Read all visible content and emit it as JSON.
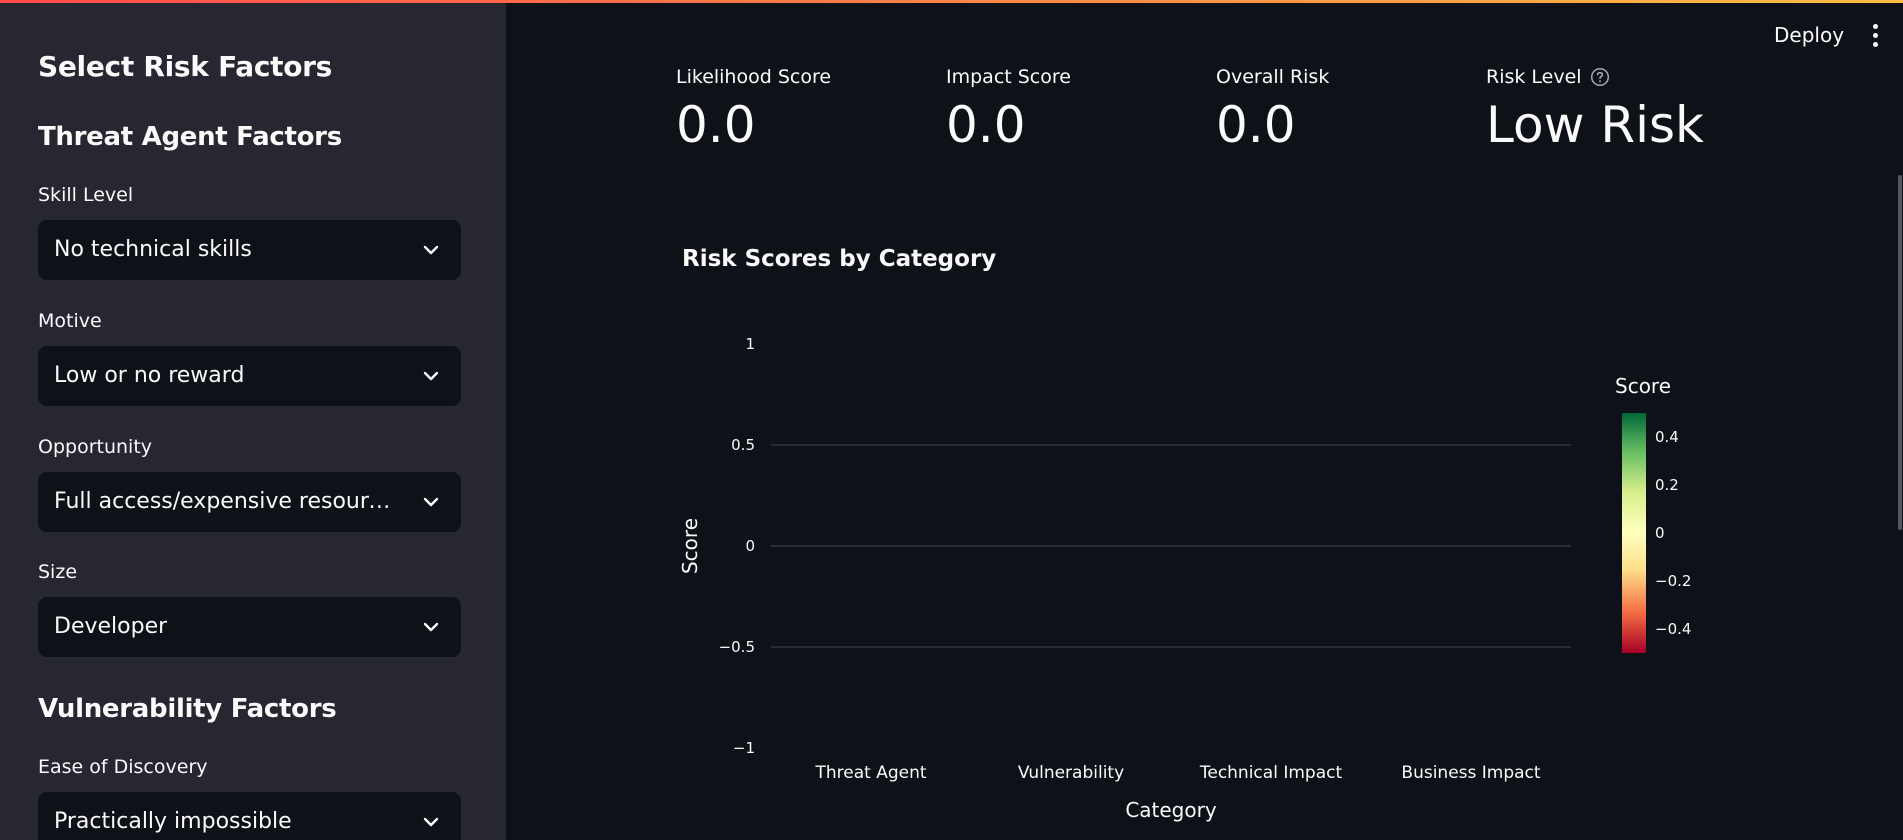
{
  "sidebar": {
    "title": "Select Risk Factors",
    "sections": {
      "threat_agent": "Threat Agent Factors",
      "vulnerability": "Vulnerability Factors"
    },
    "fields": {
      "skill_level": {
        "label": "Skill Level",
        "value": "No technical skills"
      },
      "motive": {
        "label": "Motive",
        "value": "Low or no reward"
      },
      "opportunity": {
        "label": "Opportunity",
        "value": "Full access/expensive resource ..."
      },
      "size": {
        "label": "Size",
        "value": "Developer"
      },
      "ease_of_discovery": {
        "label": "Ease of Discovery",
        "value": "Practically impossible"
      }
    }
  },
  "header": {
    "deploy_label": "Deploy",
    "menu_icon": "kebab-menu-icon"
  },
  "metrics": [
    {
      "label": "Likelihood Score",
      "value": "0.0"
    },
    {
      "label": "Impact Score",
      "value": "0.0"
    },
    {
      "label": "Overall Risk",
      "value": "0.0"
    },
    {
      "label": "Risk Level",
      "value": "Low Risk",
      "icon": "help-circle-icon"
    }
  ],
  "colors": {
    "background": "#0e1117",
    "sidebar": "#262730",
    "accent_start": "#ff4b4b",
    "accent_end": "#ffbd45",
    "colorscale": [
      "#a50026",
      "#f46d43",
      "#fee08b",
      "#ffffbf",
      "#d9ef8b",
      "#66bd63",
      "#006837"
    ]
  },
  "chart_data": {
    "type": "bar",
    "title": "Risk Scores by Category",
    "xlabel": "Category",
    "ylabel": "Score",
    "categories": [
      "Threat Agent",
      "Vulnerability",
      "Technical Impact",
      "Business Impact"
    ],
    "values": [
      0,
      0,
      0,
      0
    ],
    "ylim": [
      -1,
      1
    ],
    "yticks": [
      1,
      0.5,
      0,
      -0.5,
      -1
    ],
    "ytick_labels": [
      "1",
      "0.5",
      "0",
      "−0.5",
      "−1"
    ],
    "grid": true,
    "colorbar": {
      "title": "Score",
      "range": [
        -0.5,
        0.5
      ],
      "ticks": [
        0.4,
        0.2,
        0,
        -0.2,
        -0.4
      ],
      "tick_labels": [
        "0.4",
        "0.2",
        "0",
        "−0.2",
        "−0.4"
      ]
    }
  }
}
